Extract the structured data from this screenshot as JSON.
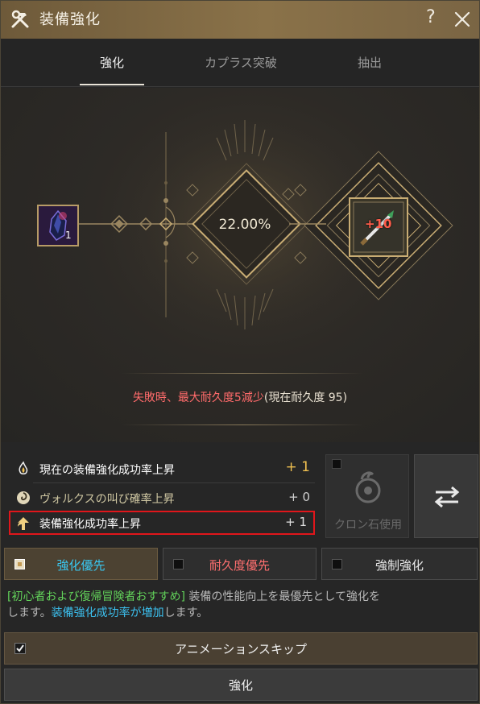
{
  "window": {
    "title": "装備強化",
    "help_label": "?"
  },
  "tabs": [
    {
      "label": "強化",
      "active": true
    },
    {
      "label": "カプラス突破",
      "active": false
    },
    {
      "label": "抽出",
      "active": false
    }
  ],
  "enhance": {
    "material_count": "1",
    "success_rate": "22.00%",
    "equip_level": "+10",
    "fail_notice_red": "失敗時、最大耐久度5減少",
    "fail_notice_rest": "(現在耐久度 95)"
  },
  "stats": [
    {
      "label": "現在の装備強化成功率上昇",
      "value": "+ 1",
      "icon": "flame-icon"
    },
    {
      "label": "ヴォルクスの叫び確率上昇",
      "value": "+ 0",
      "icon": "swirl-icon"
    },
    {
      "label": "装備強化成功率上昇",
      "value": "+ 1",
      "icon": "arrow-up-icon"
    }
  ],
  "cron": {
    "label": "クロン石使用",
    "checked": false
  },
  "priority": [
    {
      "label": "強化優先",
      "selected": true
    },
    {
      "label": "耐久度優先",
      "selected": false
    },
    {
      "label": "強制強化",
      "selected": false
    }
  ],
  "description": {
    "tag": "[初心者および復帰冒険者おすすめ]",
    "text1": " 装備の性能向上を最優先として強化を",
    "text2": "します。",
    "highlight": "装備強化成功率が増加",
    "text3": "します。"
  },
  "buttons": {
    "animation_skip": "アニメーションスキップ",
    "enhance": "強化"
  },
  "colors": {
    "accent_gold": "#f0c050",
    "warning_red": "#ff6b6b",
    "info_blue": "#3cc0ef",
    "recommend_green": "#62d25a"
  }
}
